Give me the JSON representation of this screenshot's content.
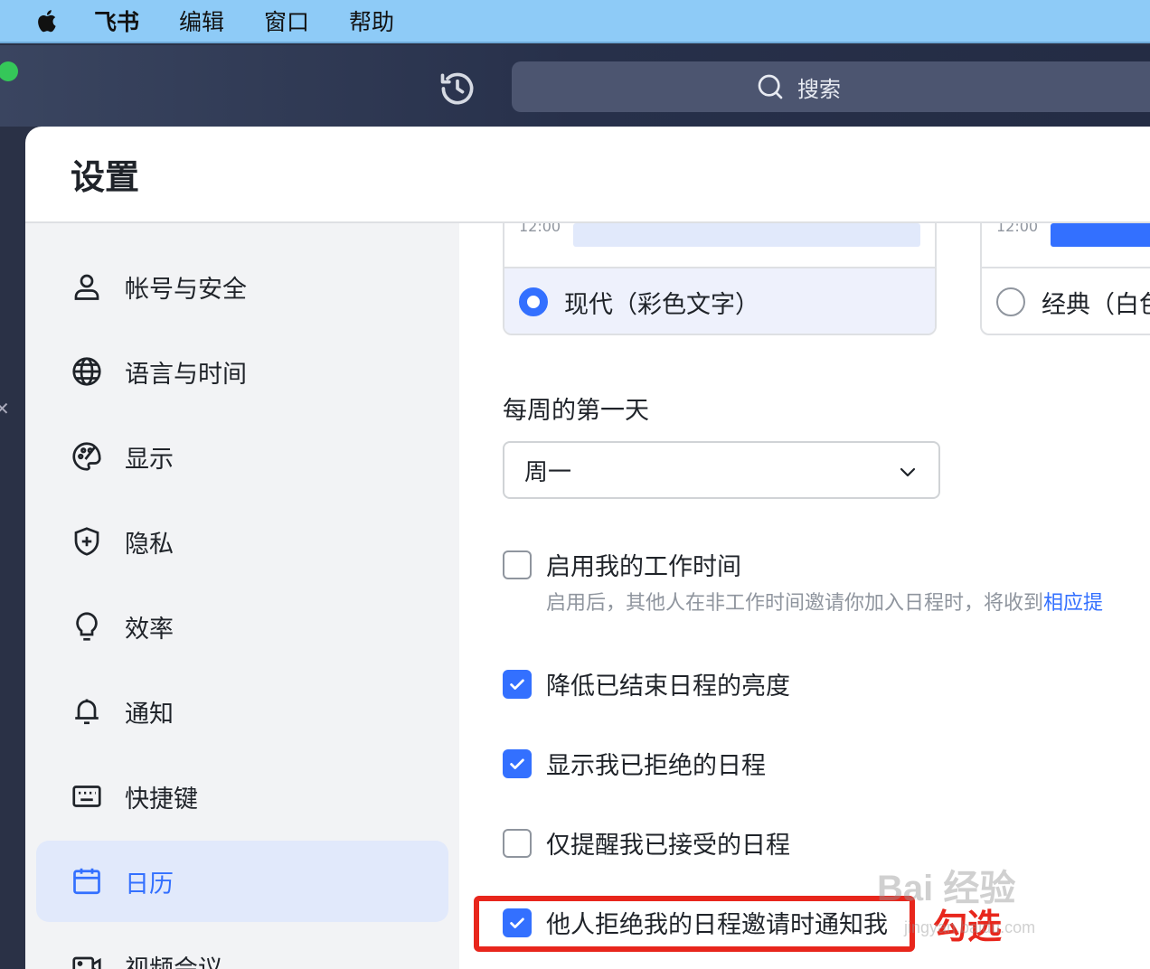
{
  "menubar": {
    "app_name": "飞书",
    "items": [
      "编辑",
      "窗口",
      "帮助"
    ]
  },
  "toolbar": {
    "search_label": "搜索"
  },
  "settings": {
    "title": "设置",
    "nav": [
      {
        "label": "帐号与安全",
        "icon": "user-icon"
      },
      {
        "label": "语言与时间",
        "icon": "globe-icon"
      },
      {
        "label": "显示",
        "icon": "palette-icon"
      },
      {
        "label": "隐私",
        "icon": "shield-icon"
      },
      {
        "label": "效率",
        "icon": "lightbulb-icon"
      },
      {
        "label": "通知",
        "icon": "bell-icon"
      },
      {
        "label": "快捷键",
        "icon": "keyboard-icon"
      },
      {
        "label": "日历",
        "icon": "calendar-icon",
        "active": true
      },
      {
        "label": "视频会议",
        "icon": "video-icon"
      }
    ]
  },
  "calendar_settings": {
    "themes": [
      {
        "label": "现代（彩色文字）",
        "selected": true,
        "preview_time": "12:00"
      },
      {
        "label": "经典（白色",
        "selected": false,
        "preview_time": "12:00"
      }
    ],
    "first_day_label": "每周的第一天",
    "first_day_value": "周一",
    "options": [
      {
        "label": "启用我的工作时间",
        "checked": false
      },
      {
        "label": "降低已结束日程的亮度",
        "checked": true
      },
      {
        "label": "显示我已拒绝的日程",
        "checked": true
      },
      {
        "label": "仅提醒我已接受的日程",
        "checked": false
      },
      {
        "label": "他人拒绝我的日程邀请时通知我",
        "checked": true
      }
    ],
    "work_hours_hint": "启用后，其他人在非工作时间邀请你加入日程时，将收到",
    "work_hours_hint_link": "相应提",
    "colors": {
      "accent": "#3370ff",
      "annotation": "#e8261c"
    }
  },
  "annotation": {
    "text": "勾选"
  },
  "watermark": {
    "brand": "Bai 经验",
    "url": "jingyan.baidu.com"
  }
}
